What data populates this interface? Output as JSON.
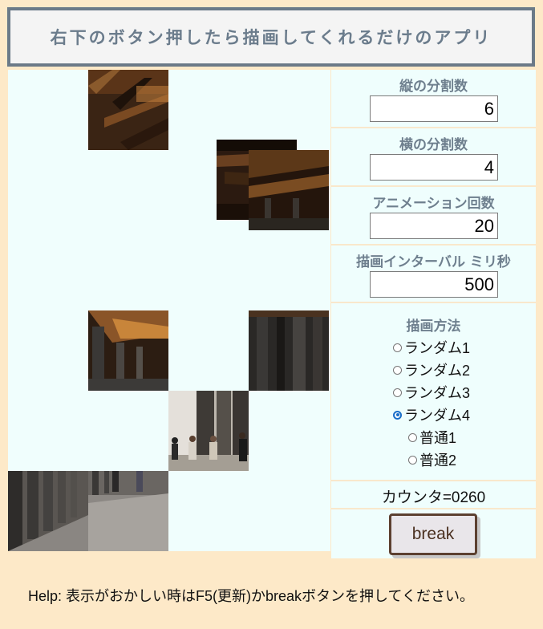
{
  "header": {
    "title": "右下のボタン押したら描画してくれるだけのアプリ"
  },
  "controls": {
    "vertical_label": "縦の分割数",
    "vertical_value": "6",
    "horizontal_label": "横の分割数",
    "horizontal_value": "4",
    "animation_label": "アニメーション回数",
    "animation_value": "20",
    "interval_label": "描画インターバル ミリ秒",
    "interval_value": "500"
  },
  "method": {
    "label": "描画方法",
    "options": [
      "ランダム1",
      "ランダム2",
      "ランダム3",
      "ランダム4",
      "普通1",
      "普通2"
    ],
    "selected": "ランダム4"
  },
  "counter": "カウンタ=0260",
  "break_button": "break",
  "help": "Help: 表示がおかしい時はF5(更新)かbreakボタンを押してください。",
  "colors": {
    "background": "#fde9c8",
    "panel": "#effefd",
    "header_border": "#6b7a88",
    "radio_selected": "#1a6fc9"
  }
}
